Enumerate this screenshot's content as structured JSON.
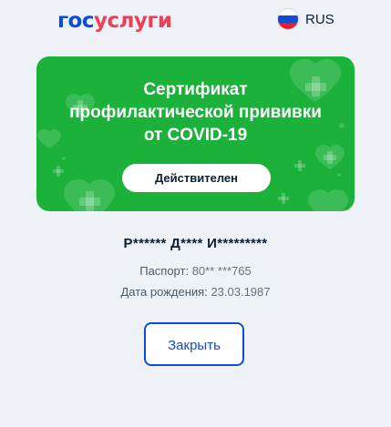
{
  "header": {
    "logo_part1": "гос",
    "logo_part2": "услуги",
    "language": "RUS"
  },
  "certificate": {
    "title": "Сертификат\nпрофилактической прививки\nот COVID-19",
    "status": "Действителен",
    "accent_color": "#1bb13b"
  },
  "person": {
    "name": "Р****** Д**** И*********",
    "passport_label": "Паспорт:",
    "passport_value": "80** ***765",
    "birth_label": "Дата рождения:",
    "birth_value": "23.03.1987"
  },
  "actions": {
    "close_label": "Закрыть"
  }
}
